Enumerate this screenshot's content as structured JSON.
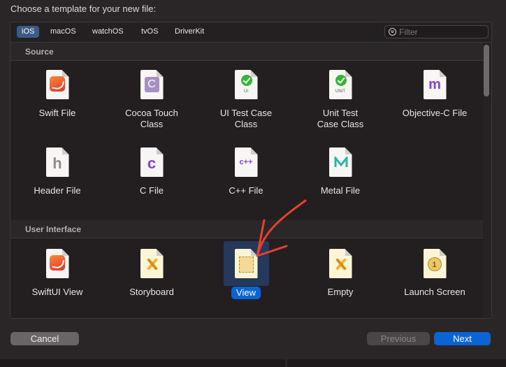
{
  "title": "Choose a template for your new file:",
  "tabs": [
    {
      "label": "iOS",
      "selected": true
    },
    {
      "label": "macOS"
    },
    {
      "label": "watchOS"
    },
    {
      "label": "tvOS"
    },
    {
      "label": "DriverKit"
    }
  ],
  "filter": {
    "placeholder": "Filter"
  },
  "sections": [
    {
      "header": "Source",
      "items": [
        {
          "label": "Swift File",
          "icon": "swift-file-icon"
        },
        {
          "label": "Cocoa Touch Class",
          "icon": "cocoa-touch-class-icon",
          "glyph": "C"
        },
        {
          "label": "UI Test Case Class",
          "icon": "ui-test-icon",
          "badge": "UI"
        },
        {
          "label": "Unit Test Case Class",
          "icon": "unit-test-icon",
          "badge": "UNIT"
        },
        {
          "label": "Objective-C File",
          "icon": "objective-c-file-icon",
          "glyph": "m"
        },
        {
          "label": "Header File",
          "icon": "header-file-icon",
          "glyph": "h"
        },
        {
          "label": "C File",
          "icon": "c-file-icon",
          "glyph": "c"
        },
        {
          "label": "C++ File",
          "icon": "cpp-file-icon",
          "glyph": "c++"
        },
        {
          "label": "Metal File",
          "icon": "metal-file-icon"
        }
      ]
    },
    {
      "header": "User Interface",
      "items": [
        {
          "label": "SwiftUI View",
          "icon": "swiftui-view-icon"
        },
        {
          "label": "Storyboard",
          "icon": "storyboard-icon"
        },
        {
          "label": "View",
          "icon": "view-icon",
          "selected": true
        },
        {
          "label": "Empty",
          "icon": "empty-interface-icon"
        },
        {
          "label": "Launch Screen",
          "icon": "launch-screen-icon",
          "glyph": "1"
        }
      ]
    }
  ],
  "buttons": {
    "cancel": "Cancel",
    "previous": "Previous",
    "next": "Next"
  },
  "colors": {
    "accent": "#0a64d6",
    "annotation_arrow": "#e8402e"
  }
}
